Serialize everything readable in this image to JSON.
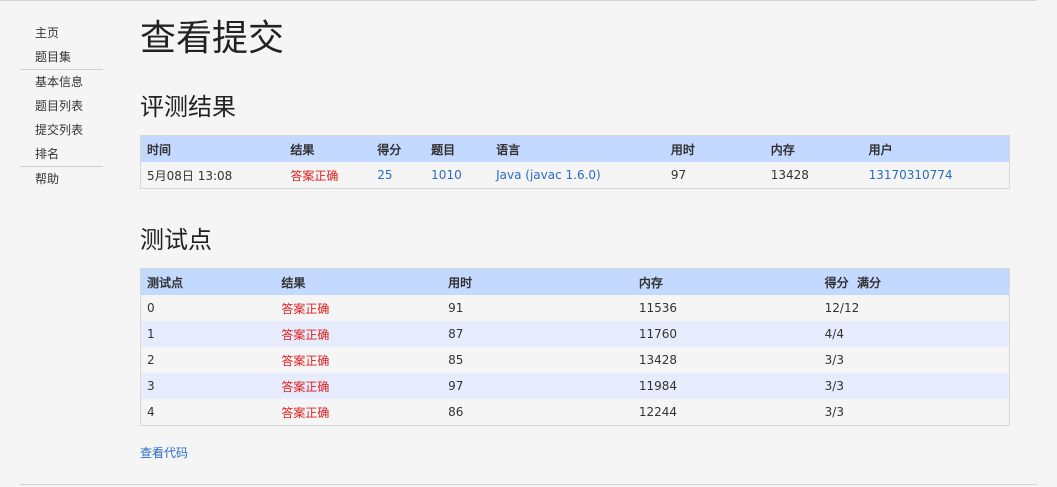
{
  "sidebar": {
    "groups": [
      [
        "主页",
        "题目集"
      ],
      [
        "基本信息",
        "题目列表",
        "提交列表",
        "排名"
      ],
      [
        "帮助"
      ]
    ]
  },
  "page_title": "查看提交",
  "judge_section": {
    "title": "评测结果",
    "headers": [
      "时间",
      "结果",
      "得分",
      "题目",
      "语言",
      "用时",
      "内存",
      "用户"
    ],
    "row": {
      "time": "5月08日 13:08",
      "result": "答案正确",
      "score": "25",
      "problem": "1010",
      "language": "Java (javac 1.6.0)",
      "duration": "97",
      "memory": "13428",
      "user": "13170310774"
    }
  },
  "testcase_section": {
    "title": "测试点",
    "headers": [
      "测试点",
      "结果",
      "用时",
      "内存",
      "得分  满分"
    ],
    "rows": [
      {
        "id": "0",
        "result": "答案正确",
        "duration": "91",
        "memory": "11536",
        "score": "12/12"
      },
      {
        "id": "1",
        "result": "答案正确",
        "duration": "87",
        "memory": "11760",
        "score": "4/4"
      },
      {
        "id": "2",
        "result": "答案正确",
        "duration": "85",
        "memory": "13428",
        "score": "3/3"
      },
      {
        "id": "3",
        "result": "答案正确",
        "duration": "97",
        "memory": "11984",
        "score": "3/3"
      },
      {
        "id": "4",
        "result": "答案正确",
        "duration": "86",
        "memory": "12244",
        "score": "3/3"
      }
    ]
  },
  "view_code_label": "查看代码",
  "colors": {
    "header_bg": "#c4d9ff",
    "row_alt_bg": "#e6ecfb",
    "accepted": "#e02020",
    "link": "#2b6cc4"
  }
}
